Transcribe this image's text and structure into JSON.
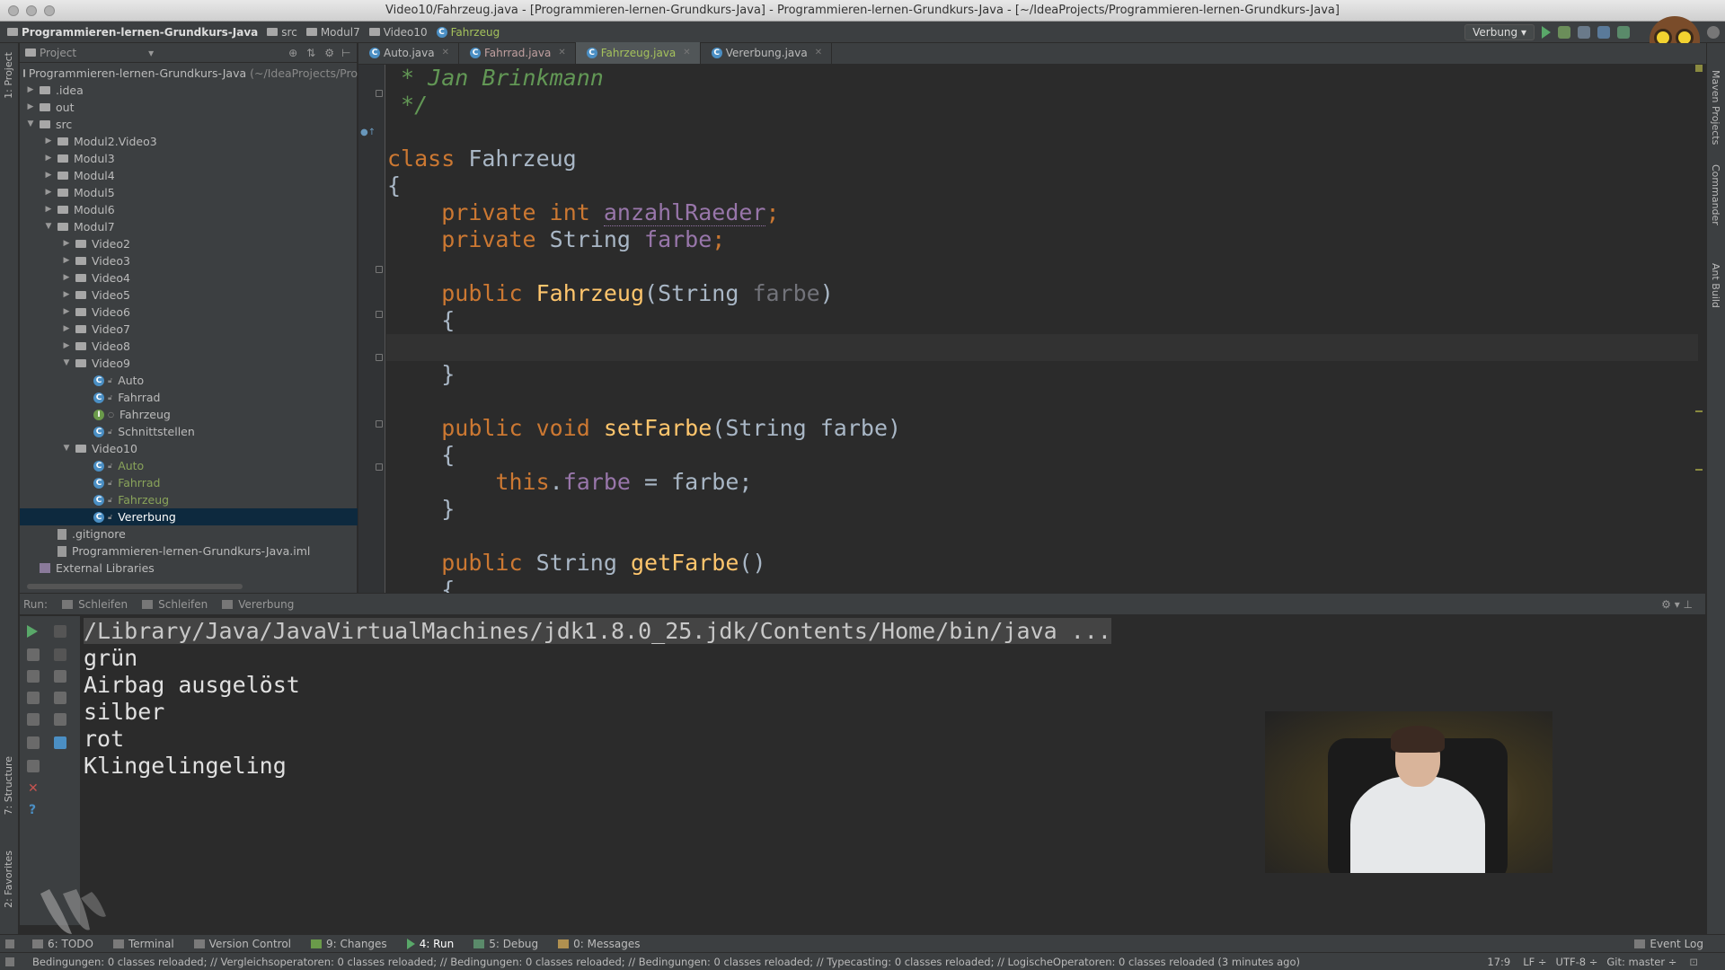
{
  "window": {
    "title": "Video10/Fahrzeug.java - [Programmieren-lernen-Grundkurs-Java] - Programmieren-lernen-Grundkurs-Java - [~/IdeaProjects/Programmieren-lernen-Grundkurs-Java]"
  },
  "breadcrumb": [
    "Programmieren-lernen-Grundkurs-Java",
    "src",
    "Modul7",
    "Video10",
    "Fahrzeug"
  ],
  "run_config": "Verbung",
  "project_panel": {
    "header": "Project",
    "root_label": "Programmieren-lernen-Grundkurs-Java",
    "root_path": "(~/IdeaProjects/Pro",
    "tree": [
      {
        "label": ".idea",
        "depth": 0,
        "type": "folder",
        "state": "collapsed"
      },
      {
        "label": "out",
        "depth": 0,
        "type": "folder",
        "state": "collapsed"
      },
      {
        "label": "src",
        "depth": 0,
        "type": "folder",
        "state": "expanded"
      },
      {
        "label": "Modul2.Video3",
        "depth": 1,
        "type": "folder",
        "state": "collapsed"
      },
      {
        "label": "Modul3",
        "depth": 1,
        "type": "folder",
        "state": "collapsed"
      },
      {
        "label": "Modul4",
        "depth": 1,
        "type": "folder",
        "state": "collapsed"
      },
      {
        "label": "Modul5",
        "depth": 1,
        "type": "folder",
        "state": "collapsed"
      },
      {
        "label": "Modul6",
        "depth": 1,
        "type": "folder",
        "state": "collapsed"
      },
      {
        "label": "Modul7",
        "depth": 1,
        "type": "folder",
        "state": "expanded"
      },
      {
        "label": "Video2",
        "depth": 2,
        "type": "folder",
        "state": "collapsed"
      },
      {
        "label": "Video3",
        "depth": 2,
        "type": "folder",
        "state": "collapsed"
      },
      {
        "label": "Video4",
        "depth": 2,
        "type": "folder",
        "state": "collapsed"
      },
      {
        "label": "Video5",
        "depth": 2,
        "type": "folder",
        "state": "collapsed"
      },
      {
        "label": "Video6",
        "depth": 2,
        "type": "folder",
        "state": "collapsed"
      },
      {
        "label": "Video7",
        "depth": 2,
        "type": "folder",
        "state": "collapsed"
      },
      {
        "label": "Video8",
        "depth": 2,
        "type": "folder",
        "state": "collapsed"
      },
      {
        "label": "Video9",
        "depth": 2,
        "type": "folder",
        "state": "expanded"
      },
      {
        "label": "Auto",
        "depth": 3,
        "type": "class",
        "state": ""
      },
      {
        "label": "Fahrrad",
        "depth": 3,
        "type": "class",
        "state": ""
      },
      {
        "label": "Fahrzeug",
        "depth": 3,
        "type": "interface",
        "state": ""
      },
      {
        "label": "Schnittstellen",
        "depth": 3,
        "type": "class",
        "state": ""
      },
      {
        "label": "Video10",
        "depth": 2,
        "type": "folder",
        "state": "expanded"
      },
      {
        "label": "Auto",
        "depth": 3,
        "type": "class-green",
        "state": ""
      },
      {
        "label": "Fahrrad",
        "depth": 3,
        "type": "class-green",
        "state": ""
      },
      {
        "label": "Fahrzeug",
        "depth": 3,
        "type": "class-green",
        "state": ""
      },
      {
        "label": "Vererbung",
        "depth": 3,
        "type": "class-selected",
        "state": ""
      },
      {
        "label": ".gitignore",
        "depth": 1,
        "type": "file",
        "state": ""
      },
      {
        "label": "Programmieren-lernen-Grundkurs-Java.iml",
        "depth": 1,
        "type": "file",
        "state": ""
      },
      {
        "label": "External Libraries",
        "depth": 0,
        "type": "library",
        "state": ""
      }
    ]
  },
  "editor_tabs": [
    {
      "label": "Auto.java",
      "active": false
    },
    {
      "label": "Fahrrad.java",
      "active": false
    },
    {
      "label": "Fahrzeug.java",
      "active": true
    },
    {
      "label": "Vererbung.java",
      "active": false
    }
  ],
  "code": {
    "comment_author": " * Jan Brinkmann",
    "comment_end": " */",
    "kw_class": "class",
    "class_name": "Fahrzeug",
    "brace_open": "{",
    "brace_close": "}",
    "kw_private": "private",
    "kw_int": "int",
    "field_anzahl": "anzahlRaeder",
    "type_string": "String",
    "field_farbe": "farbe",
    "semicolon": ";",
    "kw_public": "public",
    "kw_void": "void",
    "kw_this": "this",
    "ctor_name": "Fahrzeug",
    "param_farbe": "farbe",
    "method_set": "setFarbe",
    "method_get": "getFarbe",
    "assign": " = farbe;",
    "dot": "."
  },
  "run_panel": {
    "label": "Run:",
    "tabs": [
      "Schleifen",
      "Schleifen",
      "Vererbung"
    ],
    "command": "/Library/Java/JavaVirtualMachines/jdk1.8.0_25.jdk/Contents/Home/bin/java ...",
    "output": [
      "grün",
      "Airbag ausgelöst",
      "silber",
      "rot",
      "Klingelingeling"
    ]
  },
  "left_tool_tabs": [
    "1: Project",
    "7: Structure",
    "2: Favorites"
  ],
  "right_tool_tabs": [
    "Maven Projects",
    "Commander",
    "Ant Build"
  ],
  "bottom_tools": [
    {
      "label": "6: TODO",
      "active": false
    },
    {
      "label": "Terminal",
      "active": false
    },
    {
      "label": "Version Control",
      "active": false
    },
    {
      "label": "9: Changes",
      "active": false
    },
    {
      "label": "4: Run",
      "active": true
    },
    {
      "label": "5: Debug",
      "active": false
    },
    {
      "label": "0: Messages",
      "active": false
    }
  ],
  "event_log": "Event Log",
  "status": {
    "message": "Bedingungen: 0 classes reloaded; // Vergleichsoperatoren: 0 classes reloaded; // Bedingungen: 0 classes reloaded; // Bedingungen: 0 classes reloaded; // Typecasting: 0 classes reloaded; // LogischeOperatoren: 0 classes reloaded (3 minutes ago)",
    "position": "17:9",
    "line_sep": "LF ÷",
    "encoding": "UTF-8 ÷",
    "vcs": "Git: master ÷"
  }
}
